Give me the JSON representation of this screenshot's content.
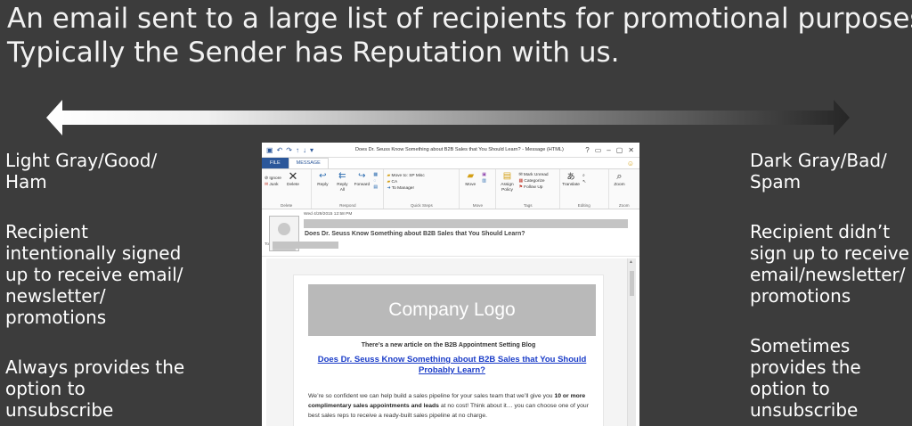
{
  "title": {
    "line1": "An email sent to a large list of recipients for promotional purposes.",
    "line2": "Typically the Sender has Reputation with us."
  },
  "left_panel": {
    "heading_line1": "Light Gray/Good/",
    "heading_line2": "Ham",
    "p1": [
      "Recipient",
      "intentionally signed",
      "up to receive email/",
      "newsletter/",
      "promotions"
    ],
    "p2": [
      "Always provides the",
      "option to",
      "unsubscribe"
    ]
  },
  "right_panel": {
    "heading_line1": "Dark Gray/Bad/",
    "heading_line2": "Spam",
    "p1": [
      "Recipient didn’t",
      "sign up to receive",
      "email/newsletter/",
      "promotions"
    ],
    "p2": [
      "Sometimes",
      "provides the",
      "option to",
      "unsubscribe"
    ]
  },
  "colors": {
    "arrow_light": "#ffffff",
    "arrow_dark": "#262626",
    "background": "#3c3c3c",
    "outlook_blue": "#2b579a",
    "link_blue": "#1a3cc8"
  },
  "outlook": {
    "window_title": "Does Dr. Seuss Know Something about B2B Sales that You Should Learn? - Message (HTML)",
    "window_buttons": [
      "?",
      "▭",
      "–",
      "▢",
      "✕"
    ],
    "tabs": {
      "file": "FILE",
      "message": "MESSAGE"
    },
    "ribbon": {
      "delete_group": {
        "ignore": "Ignore",
        "junk": "Junk",
        "delete": "Delete",
        "name": "Delete"
      },
      "respond_group": {
        "reply": "Reply",
        "reply_all_1": "Reply",
        "reply_all_2": "All",
        "forward": "Forward",
        "name": "Respond"
      },
      "quick_steps": {
        "item1": "Move to: SP Misc",
        "item2": "CA",
        "item3": "To Manager",
        "name": "Quick Steps"
      },
      "move_group": {
        "move": "Move",
        "name": "Move"
      },
      "tags_group": {
        "assign_1": "Assign",
        "assign_2": "Policy",
        "mark_unread": "Mark Unread",
        "categorize": "Categorize",
        "follow_up": "Follow Up",
        "name": "Tags"
      },
      "editing_group": {
        "translate": "Translate",
        "name": "Editing"
      },
      "zoom_group": {
        "zoom": "Zoom",
        "name": "Zoom"
      }
    },
    "message": {
      "date": "Wed 4/29/2015 12:58 PM",
      "subject": "Does Dr. Seuss Know Something about B2B Sales that You Should Learn?",
      "to_label": "To"
    },
    "email": {
      "logo_text": "Company Logo",
      "intro": "There’s a new article on the B2B Appointment Setting Blog",
      "link_line1": "Does Dr. Seuss Know Something about B2B Sales that You Should",
      "link_line2": "Probably Learn?",
      "para_a": "We’re so confident we can help build a sales pipeline for your sales team that we’ll give you ",
      "para_bold1": "10 or more",
      "para_bold2": "complimentary sales appointments and leads",
      "para_b": " at no cost! Think about it… you can choose one of your",
      "para_c": "best sales reps to receive a ready-built sales pipeline at no charge."
    }
  }
}
